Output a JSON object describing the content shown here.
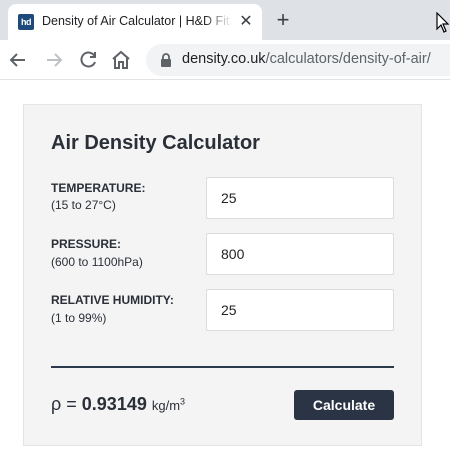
{
  "browser": {
    "tab": {
      "favicon_text": "hd",
      "title": "Density of Air Calculator | H&D Fitzgerald",
      "close_glyph": "✕"
    },
    "new_tab_glyph": "+",
    "url": {
      "host": "density.co.uk",
      "path": "/calculators/density-of-air/"
    }
  },
  "calculator": {
    "title": "Air Density Calculator",
    "temperature": {
      "label": "TEMPERATURE:",
      "range": "(15 to 27°C)",
      "value": "25"
    },
    "pressure": {
      "label": "PRESSURE:",
      "range": "(600 to 1100hPa)",
      "value": "800"
    },
    "humidity": {
      "label": "RELATIVE HUMIDITY:",
      "range": "(1 to 99%)",
      "value": "25"
    },
    "result": {
      "symbol": "ρ =",
      "value": "0.93149",
      "unit": "kg/m",
      "unit_exp": "3"
    },
    "calculate_label": "Calculate"
  },
  "colors": {
    "button_bg": "#2a3444",
    "divider": "#2b3a4b",
    "card_bg": "#f4f4f4"
  }
}
